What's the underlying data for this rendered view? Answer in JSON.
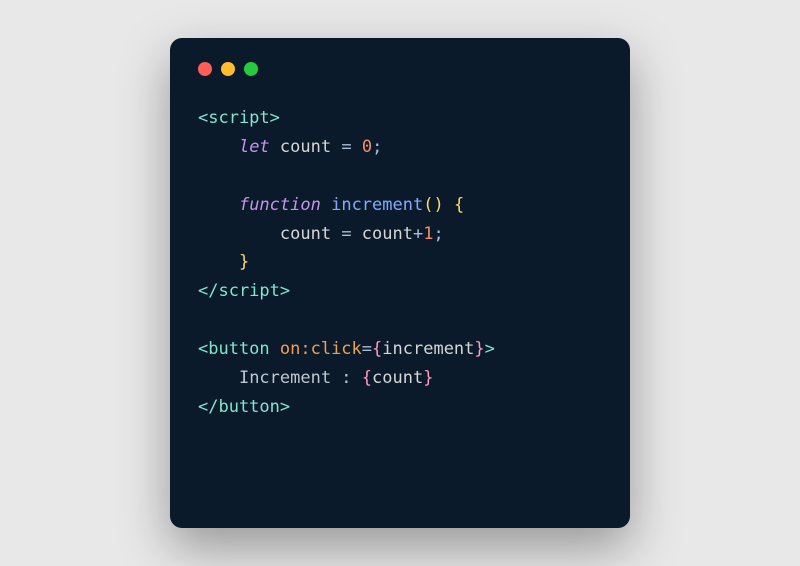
{
  "traffic_lights": {
    "red": "#ff5f56",
    "yellow": "#ffbd2e",
    "green": "#27c93f"
  },
  "code": {
    "line1": {
      "open": "<script>"
    },
    "line2": {
      "indent": "    ",
      "kw": "let",
      "ident": " count ",
      "eq": "=",
      "sp": " ",
      "num": "0",
      "semi": ";"
    },
    "line3": {
      "blank": ""
    },
    "line4": {
      "indent": "    ",
      "kw": "function",
      "sp": " ",
      "fn": "increment",
      "paren": "()",
      "sp2": " ",
      "brace": "{"
    },
    "line5": {
      "indent": "        ",
      "ident1": "count ",
      "eq": "=",
      "ident2": " count",
      "plus": "+",
      "num": "1",
      "semi": ";"
    },
    "line6": {
      "indent": "    ",
      "brace": "}"
    },
    "line7": {
      "close": "</script>"
    },
    "line8": {
      "blank": ""
    },
    "line9": {
      "open1": "<button ",
      "attr": "on:click",
      "eq": "=",
      "brace1": "{",
      "ident": "increment",
      "brace2": "}",
      "close": ">"
    },
    "line10": {
      "indent": "    ",
      "txt1": "Increment : ",
      "brace1": "{",
      "ident": "count",
      "brace2": "}"
    },
    "line11": {
      "close": "</button>"
    }
  }
}
